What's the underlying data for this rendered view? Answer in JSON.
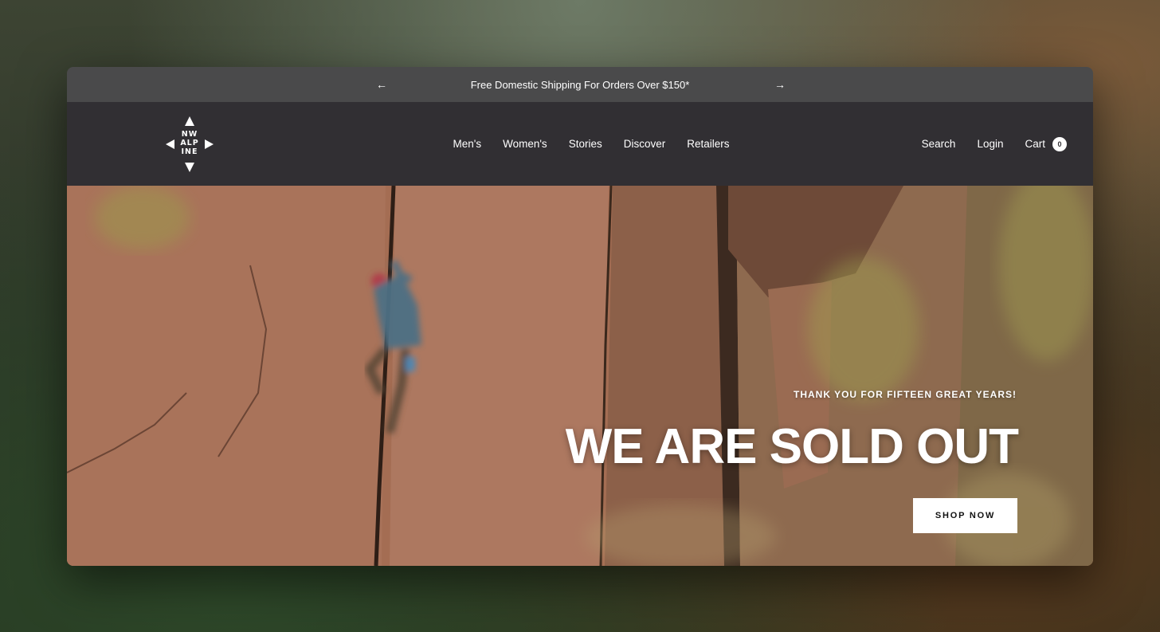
{
  "announcement": {
    "text": "Free Domestic Shipping For Orders Over $150*",
    "prev_icon": "arrow-left-icon",
    "next_icon": "arrow-right-icon"
  },
  "logo": {
    "line1": "NW",
    "line2": "ALP",
    "line3": "INE"
  },
  "nav": {
    "items": [
      {
        "label": "Men's"
      },
      {
        "label": "Women's"
      },
      {
        "label": "Stories"
      },
      {
        "label": "Discover"
      },
      {
        "label": "Retailers"
      }
    ]
  },
  "header_links": {
    "search": "Search",
    "login": "Login",
    "cart": "Cart",
    "cart_count": "0"
  },
  "hero": {
    "subtitle": "THANK YOU FOR FIFTEEN GREAT YEARS!",
    "title": "WE ARE SOLD OUT",
    "cta": "SHOP NOW"
  },
  "colors": {
    "announcement_bg": "#4a4a4b",
    "header_bg": "#312f33",
    "text": "#ffffff",
    "button_bg": "#ffffff",
    "button_text": "#111111"
  }
}
